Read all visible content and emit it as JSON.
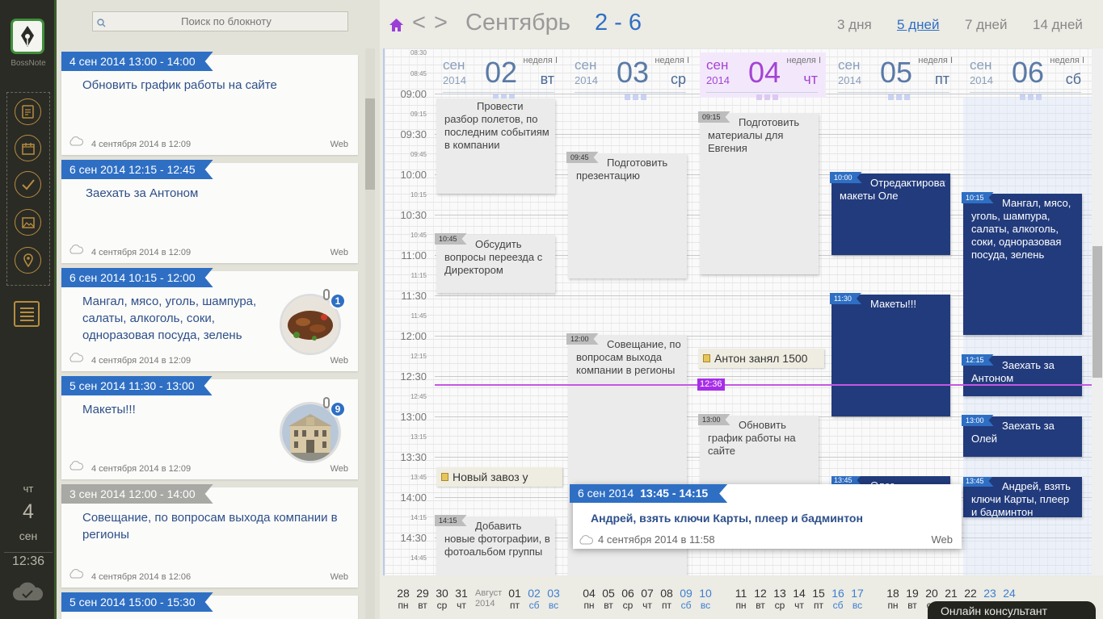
{
  "app": {
    "logo_text": "BossNote",
    "rail": {
      "weekday": "чт",
      "day": "4",
      "month": "сен",
      "time": "12:36"
    }
  },
  "search": {
    "placeholder": "Поиск по блокноту"
  },
  "notes": [
    {
      "ribbon": "4 сен 2014 13:00 - 14:00",
      "text": "Обновить график работы на сайте",
      "date": "4 сентября 2014 в 12:09",
      "source": "Web"
    },
    {
      "ribbon": "6 сен 2014 12:15 - 12:45",
      "text": "Заехать за Антоном",
      "date": "4 сентября 2014 в 12:09",
      "source": "Web"
    },
    {
      "ribbon": "6 сен 2014 10:15 - 12:00",
      "text": "Мангал, мясо, уголь, шампура, салаты, алкоголь, соки, одноразовая посуда, зелень",
      "date": "4 сентября 2014 в 12:09",
      "source": "Web",
      "badge": "1"
    },
    {
      "ribbon": "5 сен 2014 11:30 - 13:00",
      "text": "Макеты!!!",
      "date": "4 сентября 2014 в 12:09",
      "source": "Web",
      "badge": "9"
    },
    {
      "ribbon": "3 сен 2014 12:00 - 14:00",
      "text": "Совещание, по вопросам выхода компании в регионы",
      "date": "4 сентября 2014 в 12:06",
      "source": "Web"
    },
    {
      "ribbon": "5 сен 2014 15:00 - 15:30"
    }
  ],
  "calendar": {
    "nav": "< >",
    "month": "Сентябрь",
    "range": "2 - 6",
    "views": [
      "3 дня",
      "5 дней",
      "7 дней",
      "14 дней"
    ],
    "active_view": "5 дней",
    "time_labels_big": [
      "08:30",
      "09:00",
      "09:30",
      "10:00",
      "10:30",
      "11:00",
      "11:30",
      "12:00",
      "12:30",
      "13:00",
      "13:30",
      "14:00",
      "14:30"
    ],
    "time_labels_small": [
      "08:45",
      "09:15",
      "09:45",
      "10:15",
      "10:45",
      "11:15",
      "11:45",
      "12:15",
      "12:45",
      "13:15",
      "13:45",
      "14:15",
      "14:45"
    ],
    "days": [
      {
        "mon": "сен",
        "year": "2014",
        "num": "02",
        "week": "неделя I",
        "wd": "вт"
      },
      {
        "mon": "сен",
        "year": "2014",
        "num": "03",
        "week": "неделя I",
        "wd": "ср"
      },
      {
        "mon": "сен",
        "year": "2014",
        "num": "04",
        "week": "неделя I",
        "wd": "чт"
      },
      {
        "mon": "сен",
        "year": "2014",
        "num": "05",
        "week": "неделя I",
        "wd": "пт"
      },
      {
        "mon": "сен",
        "year": "2014",
        "num": "06",
        "week": "неделя I",
        "wd": "сб"
      }
    ],
    "events": [
      {
        "time": "",
        "title": "Провести разбор полетов, по последним событиям в компании"
      },
      {
        "time": "10:45",
        "title": "Обсудить вопросы переезда с Директором"
      },
      {
        "time": "14:15",
        "title": "Добавить новые фотографии, в фотоальбом группы"
      },
      {
        "time": "09:45",
        "title": "Подготовить презентацию"
      },
      {
        "time": "12:00",
        "title": "Совещание, по вопросам выхода компании в регионы"
      },
      {
        "time": "09:15",
        "title": "Подготовить материалы для Евгения"
      },
      {
        "time": "13:00",
        "title": "Обновить график работы на сайте"
      },
      {
        "time": "10:00",
        "title": "Отредактировать макеты Оле"
      },
      {
        "time": "11:30",
        "title": "Макеты!!!"
      },
      {
        "time": "13:45",
        "title": "Олег"
      },
      {
        "time": "10:15",
        "title": "Мангал, мясо, уголь, шампура, салаты, алкоголь, соки, одноразовая посуда, зелень"
      },
      {
        "time": "12:15",
        "title": "Заехать за Антоном"
      },
      {
        "time": "13:00",
        "title": "Заехать за Олей"
      },
      {
        "time": "13:45",
        "title": "Андрей, взять ключи Карты, плеер и бадминтон"
      }
    ],
    "quick_notes": [
      "Антон занял 1500",
      "Новый завоз у"
    ],
    "now_label": "12:36",
    "popup": {
      "ribbon_date": "6 сен 2014",
      "ribbon_time": "13:45 - 14:15",
      "title": "Андрей, взять ключи Карты, плеер и бадминтон",
      "date": "4 сентября 2014 в 11:58",
      "source": "Web"
    }
  },
  "datestrip": {
    "month_label": "Август",
    "year_label": "2014",
    "days": [
      {
        "n": "28",
        "wd": "пн"
      },
      {
        "n": "29",
        "wd": "вт"
      },
      {
        "n": "30",
        "wd": "ср"
      },
      {
        "n": "31",
        "wd": "чт"
      },
      {
        "n": "01",
        "wd": "пт"
      },
      {
        "n": "02",
        "wd": "сб"
      },
      {
        "n": "03",
        "wd": "вс"
      },
      {
        "n": "04",
        "wd": "пн"
      },
      {
        "n": "05",
        "wd": "вт"
      },
      {
        "n": "06",
        "wd": "ср"
      },
      {
        "n": "07",
        "wd": "чт"
      },
      {
        "n": "08",
        "wd": "пт"
      },
      {
        "n": "09",
        "wd": "сб"
      },
      {
        "n": "10",
        "wd": "вс"
      },
      {
        "n": "11",
        "wd": "пн"
      },
      {
        "n": "12",
        "wd": "вт"
      },
      {
        "n": "13",
        "wd": "ср"
      },
      {
        "n": "14",
        "wd": "чт"
      },
      {
        "n": "15",
        "wd": "пт"
      },
      {
        "n": "16",
        "wd": "сб"
      },
      {
        "n": "17",
        "wd": "вс"
      },
      {
        "n": "18",
        "wd": "пн"
      },
      {
        "n": "19",
        "wd": "вт"
      },
      {
        "n": "20",
        "wd": "ср"
      },
      {
        "n": "21",
        "wd": "чт"
      },
      {
        "n": "22",
        "wd": "пт"
      },
      {
        "n": "23",
        "wd": "сб"
      },
      {
        "n": "24",
        "wd": "вс"
      }
    ],
    "consultant": "Онлайн консультант"
  },
  "colors": {
    "accent": "#2e6fc4",
    "today": "#a444d4",
    "event_dark": "#223b7c",
    "rail": "#2a2b25"
  },
  "icons": [
    "logo-icon",
    "notes-icon",
    "calendar-icon",
    "check-icon",
    "image-icon",
    "location-icon",
    "list-icon",
    "cloud-icon",
    "search-icon",
    "home-icon",
    "paperclip-icon"
  ]
}
